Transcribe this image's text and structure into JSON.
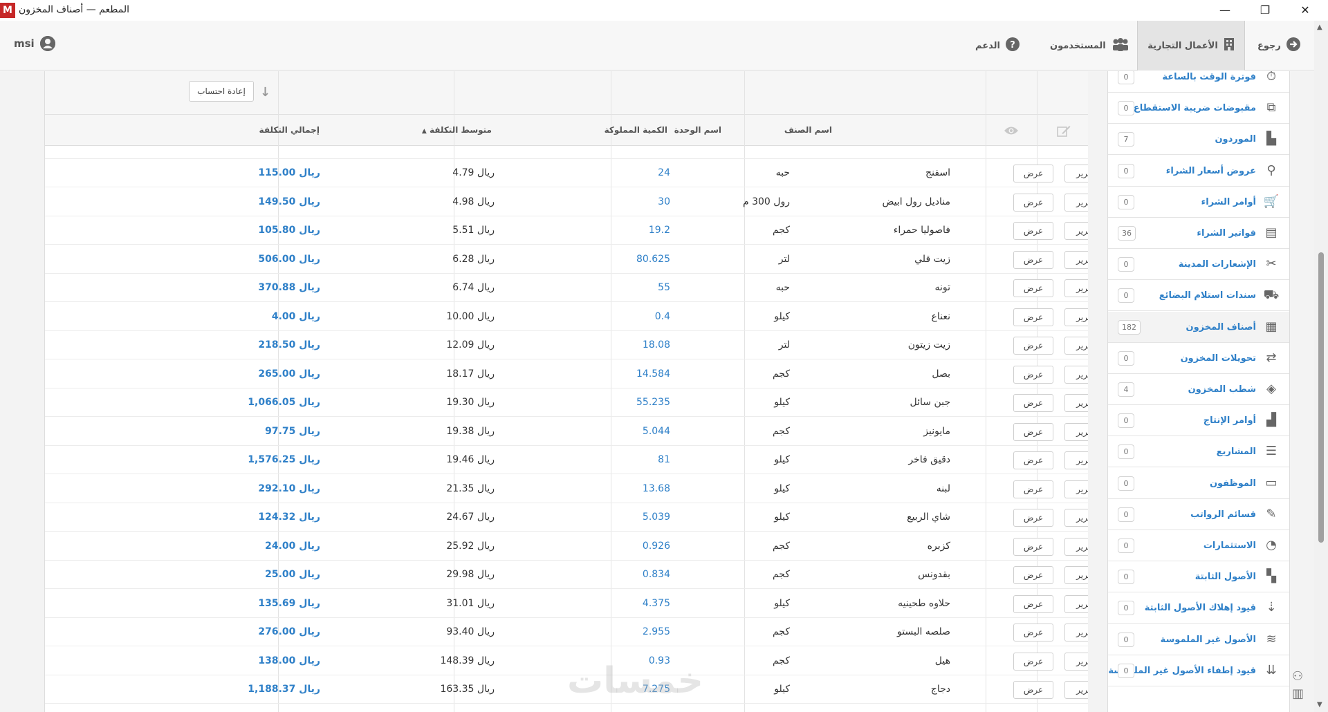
{
  "window": {
    "app_icon": "M",
    "title": "المطعم — أصناف المخزون",
    "minimize": "—",
    "restore": "❐",
    "close": "✕"
  },
  "header": {
    "back": "رجوع",
    "business": "الأعمال التجارية",
    "users": "المستخدمون",
    "support": "الدعم",
    "user": "msi"
  },
  "toolbar": {
    "recalc": "إعادة احتساب"
  },
  "table": {
    "headers": {
      "item_name": "اسم الصنف",
      "unit_name": "اسم الوحدة",
      "qty_owned": "الكمية المملوكة",
      "avg_cost": "متوسط التكلفة",
      "total_cost": "إجمالي التكلفة"
    },
    "view_label": "عرض",
    "edit_label": "تحرير",
    "rows": [
      {
        "name": "اسفنج",
        "unit": "حبه",
        "qty": "24",
        "avg": "ريال 4.79",
        "total": "ريال 115.00"
      },
      {
        "name": "مناديل رول ابيض",
        "unit": "رول 300 م",
        "qty": "30",
        "avg": "ريال 4.98",
        "total": "ريال 149.50"
      },
      {
        "name": "فاصوليا حمراء",
        "unit": "كجم",
        "qty": "19.2",
        "avg": "ريال 5.51",
        "total": "ريال 105.80"
      },
      {
        "name": "زيت قلي",
        "unit": "لتر",
        "qty": "80.625",
        "avg": "ريال 6.28",
        "total": "ريال 506.00"
      },
      {
        "name": "تونه",
        "unit": "حبه",
        "qty": "55",
        "avg": "ريال 6.74",
        "total": "ريال 370.88"
      },
      {
        "name": "نعناع",
        "unit": "كيلو",
        "qty": "0.4",
        "avg": "ريال 10.00",
        "total": "ريال 4.00"
      },
      {
        "name": "زيت زيتون",
        "unit": "لتر",
        "qty": "18.08",
        "avg": "ريال 12.09",
        "total": "ريال 218.50"
      },
      {
        "name": "بصل",
        "unit": "كجم",
        "qty": "14.584",
        "avg": "ريال 18.17",
        "total": "ريال 265.00"
      },
      {
        "name": "جبن سائل",
        "unit": "كيلو",
        "qty": "55.235",
        "avg": "ريال 19.30",
        "total": "ريال 1,066.05"
      },
      {
        "name": "مايونيز",
        "unit": "كجم",
        "qty": "5.044",
        "avg": "ريال 19.38",
        "total": "ريال 97.75"
      },
      {
        "name": "دقيق فاخر",
        "unit": "كيلو",
        "qty": "81",
        "avg": "ريال 19.46",
        "total": "ريال 1,576.25"
      },
      {
        "name": "لبنه",
        "unit": "كيلو",
        "qty": "13.68",
        "avg": "ريال 21.35",
        "total": "ريال 292.10"
      },
      {
        "name": "شاي الربيع",
        "unit": "كيلو",
        "qty": "5.039",
        "avg": "ريال 24.67",
        "total": "ريال 124.32"
      },
      {
        "name": "كزبره",
        "unit": "كجم",
        "qty": "0.926",
        "avg": "ريال 25.92",
        "total": "ريال 24.00"
      },
      {
        "name": "بقدونس",
        "unit": "كجم",
        "qty": "0.834",
        "avg": "ريال 29.98",
        "total": "ريال 25.00"
      },
      {
        "name": "حلاوه طحينيه",
        "unit": "كيلو",
        "qty": "4.375",
        "avg": "ريال 31.01",
        "total": "ريال 135.69"
      },
      {
        "name": "صلصه البستو",
        "unit": "كجم",
        "qty": "2.955",
        "avg": "ريال 93.40",
        "total": "ريال 276.00"
      },
      {
        "name": "هيل",
        "unit": "كجم",
        "qty": "0.93",
        "avg": "ريال 148.39",
        "total": "ريال 138.00"
      },
      {
        "name": "دجاج",
        "unit": "كيلو",
        "qty": "7.275",
        "avg": "ريال 163.35",
        "total": "ريال 1,188.37"
      }
    ]
  },
  "sidebar": {
    "items": [
      {
        "label": "فوترة الوقت بالساعة",
        "badge": "0",
        "icon": "stopwatch-icon"
      },
      {
        "label": "مقبوضات ضريبة الاستقطاع",
        "badge": "0",
        "icon": "receipt-icon"
      },
      {
        "label": "الموردون",
        "badge": "7",
        "icon": "factory-icon"
      },
      {
        "label": "عروض أسعار الشراء",
        "badge": "0",
        "icon": "quote-icon"
      },
      {
        "label": "أوامر الشراء",
        "badge": "0",
        "icon": "cart-icon"
      },
      {
        "label": "فواتير الشراء",
        "badge": "36",
        "icon": "invoice-icon"
      },
      {
        "label": "الإشعارات المدينة",
        "badge": "0",
        "icon": "scissors-icon"
      },
      {
        "label": "سندات استلام البضائع",
        "badge": "0",
        "icon": "truck-icon"
      },
      {
        "label": "أصناف المخزون",
        "badge": "182",
        "icon": "shelves-icon"
      },
      {
        "label": "تحويلات المخزون",
        "badge": "0",
        "icon": "transfer-icon"
      },
      {
        "label": "شطب المخزون",
        "badge": "4",
        "icon": "eraser-icon"
      },
      {
        "label": "أوامر الإنتاج",
        "badge": "0",
        "icon": "production-icon"
      },
      {
        "label": "المشاريع",
        "badge": "0",
        "icon": "gantt-icon"
      },
      {
        "label": "الموظفون",
        "badge": "0",
        "icon": "id-card-icon"
      },
      {
        "label": "قسائم الرواتب",
        "badge": "0",
        "icon": "payslip-icon"
      },
      {
        "label": "الاستثمارات",
        "badge": "0",
        "icon": "pie-chart-icon"
      },
      {
        "label": "الأصول الثابتة",
        "badge": "0",
        "icon": "building-icon"
      },
      {
        "label": "قيود إهلاك الأصول الثابتة",
        "badge": "0",
        "icon": "sort-down-icon"
      },
      {
        "label": "الأصول غير الملموسة",
        "badge": "0",
        "icon": "wind-icon"
      },
      {
        "label": "قيود إطفاء الأصول غير الملموسة",
        "badge": "0",
        "icon": "sort-amount-icon"
      }
    ]
  },
  "watermark": "خمسات"
}
